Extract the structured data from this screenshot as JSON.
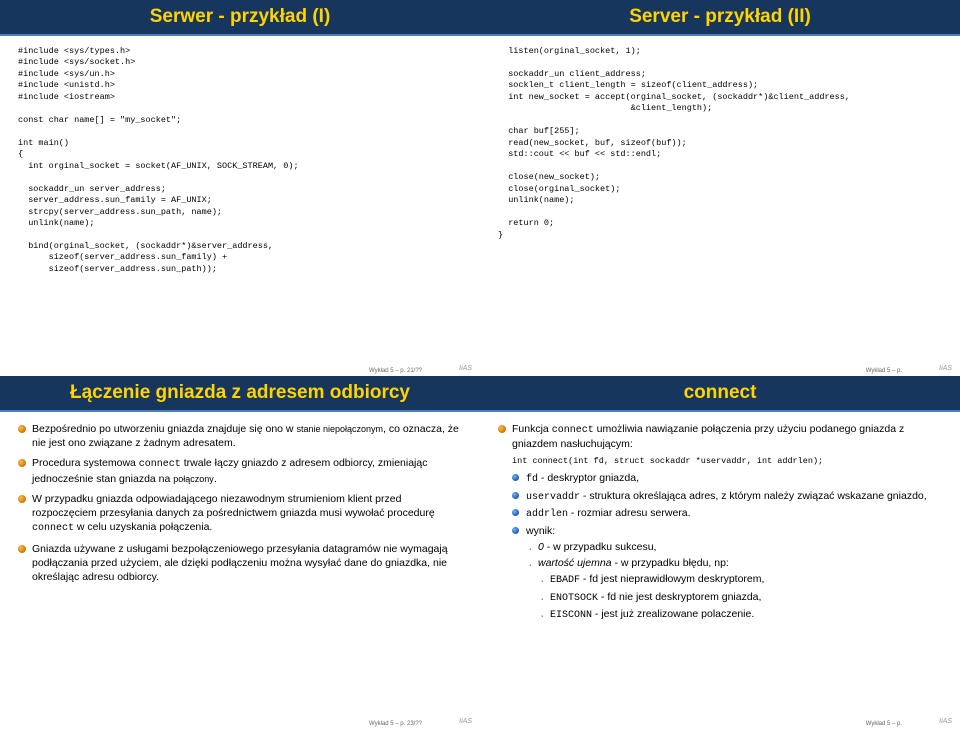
{
  "slide1": {
    "title": "Serwer - przykład (I)",
    "code": "#include <sys/types.h>\n#include <sys/socket.h>\n#include <sys/un.h>\n#include <unistd.h>\n#include <iostream>\n\nconst char name[] = \"my_socket\";\n\nint main()\n{\n  int orginal_socket = socket(AF_UNIX, SOCK_STREAM, 0);\n\n  sockaddr_un server_address;\n  server_address.sun_family = AF_UNIX;\n  strcpy(server_address.sun_path, name);\n  unlink(name);\n\n  bind(orginal_socket, (sockaddr*)&server_address,\n      sizeof(server_address.sun_family) +\n      sizeof(server_address.sun_path));",
    "footer": "Wykład 5 – p. 21/??"
  },
  "slide2": {
    "title": "Server - przykład (II)",
    "code": "  listen(orginal_socket, 1);\n\n  sockaddr_un client_address;\n  socklen_t client_length = sizeof(client_address);\n  int new_socket = accept(orginal_socket, (sockaddr*)&client_address,\n                          &client_length);\n\n  char buf[255];\n  read(new_socket, buf, sizeof(buf));\n  std::cout << buf << std::endl;\n\n  close(new_socket);\n  close(orginal_socket);\n  unlink(name);\n\n  return 0;\n}",
    "footer": "Wykład 5 – p."
  },
  "slide3": {
    "title": "Łączenie gniazda z adresem odbiorcy",
    "b1a": "Bezpośrednio po utworzeniu gniazda znajduje się ono w ",
    "b1b": "stanie niepołączonym",
    "b1c": ", co oznacza, że nie jest ono związane z żadnym adresatem.",
    "b2a": "Procedura systemowa ",
    "b2b": "connect",
    "b2c": " trwale łączy gniazdo z adresem odbiorcy, zmieniając jednocześnie stan gniazda na ",
    "b2d": "połączony",
    "b2e": ".",
    "b3a": "W przypadku gniazda odpowiadającego niezawodnym strumieniom klient przed rozpoczęciem przesyłania danych za pośrednictwem gniazda musi wywołać procedurę ",
    "b3b": "connect",
    "b3c": " w celu uzyskania połączenia.",
    "b4": "Gniazda używane z usługami bezpołączeniowego przesyłania datagramów nie wymagają podłączania przed użyciem, ale dzięki podłączeniu można wysyłać dane do gniazdka, nie określając adresu odbiorcy.",
    "footer": "Wykład 5 – p. 23/??"
  },
  "slide4": {
    "title": "connect",
    "b1a": "Funkcja ",
    "b1b": "connect",
    "b1c": " umożliwia nawiązanie połączenia przy użyciu podanego gniazda z gniazdem nasłuchującym:",
    "code": "int connect(int fd, struct sockaddr *uservaddr, int addrlen);",
    "s1a": "fd",
    "s1b": " - deskryptor gniazda,",
    "s2a": "uservaddr",
    "s2b": " - struktura określająca adres, z którym należy związać wskazane gniazdo,",
    "s3a": "addrlen",
    "s3b": " - rozmiar adresu serwera.",
    "s4": "wynik:",
    "r1a": "0",
    "r1b": " - w przypadku sukcesu,",
    "r2a": "wartość ujemna",
    "r2b": " - w przypadku błędu, np:",
    "e1a": "EBADF",
    "e1b": " - fd jest nieprawidłowym deskryptorem,",
    "e2a": "ENOTSOCK",
    "e2b": " - fd nie jest deskryptorem gniazda,",
    "e3a": "EISCONN",
    "e3b": " - jest już zrealizowane polaczenie.",
    "footer": "Wykład 5 – p."
  },
  "logo": "IiAS"
}
